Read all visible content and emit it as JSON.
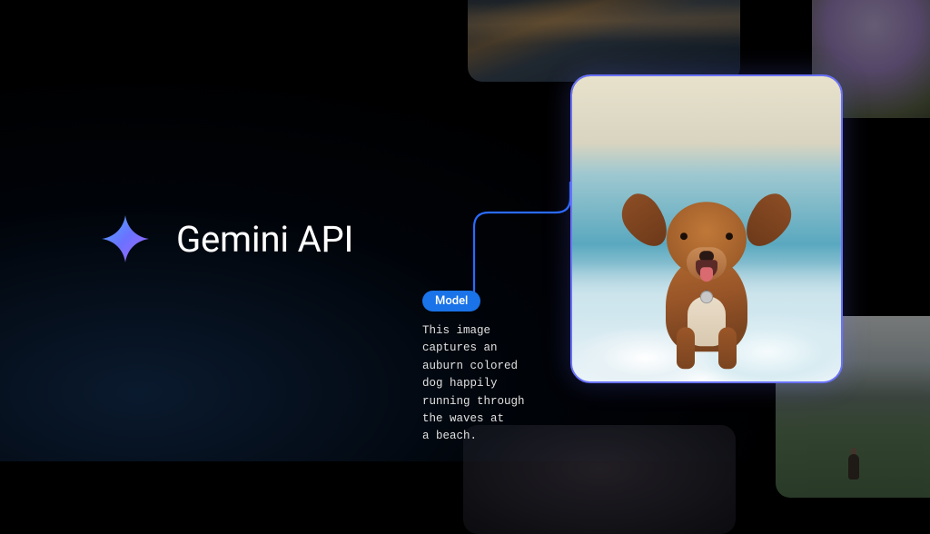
{
  "brand": {
    "title": "Gemini API"
  },
  "output": {
    "badge": "Model",
    "caption": "This image\ncaptures an\nauburn colored\ndog happily\nrunning through\nthe waves at\na beach."
  },
  "gallery": {
    "featured_alt": "auburn dog running through beach waves",
    "tiles": [
      "highway-long-exposure",
      "purple-flower-macro",
      "blueberries",
      "mountain-hiker"
    ]
  },
  "colors": {
    "accent": "#6a72ff",
    "badge": "#1a73e8"
  }
}
